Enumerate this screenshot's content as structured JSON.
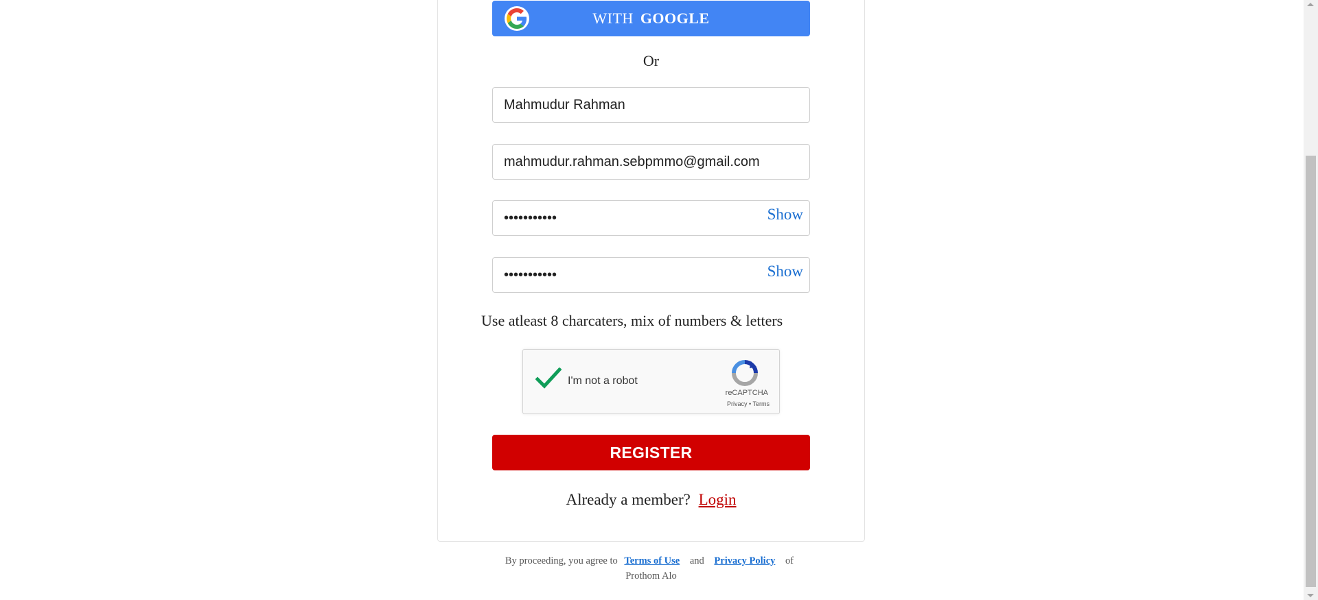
{
  "google_button": {
    "with_label": "WITH",
    "brand_label": "GOOGLE",
    "icon": "google-icon"
  },
  "divider": {
    "label": "Or"
  },
  "form": {
    "name_value": "Mahmudur Rahman",
    "email_value": "mahmudur.rahman.sebpmmo@gmail.com",
    "password_value": "•••••••••••",
    "confirm_password_value": "•••••••••••",
    "show_label": "Show",
    "password_hint": "Use atleast 8 charcaters, mix of numbers & letters"
  },
  "captcha": {
    "label": "I'm not a robot",
    "brand": "reCAPTCHA",
    "privacy": "Privacy",
    "separator": "•",
    "terms": "Terms",
    "checked": true
  },
  "register_button": {
    "label": "REGISTER",
    "color": "#d10000"
  },
  "member": {
    "prompt": "Already a member?",
    "login_label": "Login"
  },
  "footer": {
    "prefix": "By proceeding, you agree to",
    "terms_label": "Terms of Use",
    "and": "and",
    "privacy_label": "Privacy Policy",
    "of": "of",
    "brand": "Prothom Alo"
  },
  "colors": {
    "google_blue": "#4285f4",
    "link_blue": "#1b6fd1",
    "login_red": "#c00000"
  }
}
